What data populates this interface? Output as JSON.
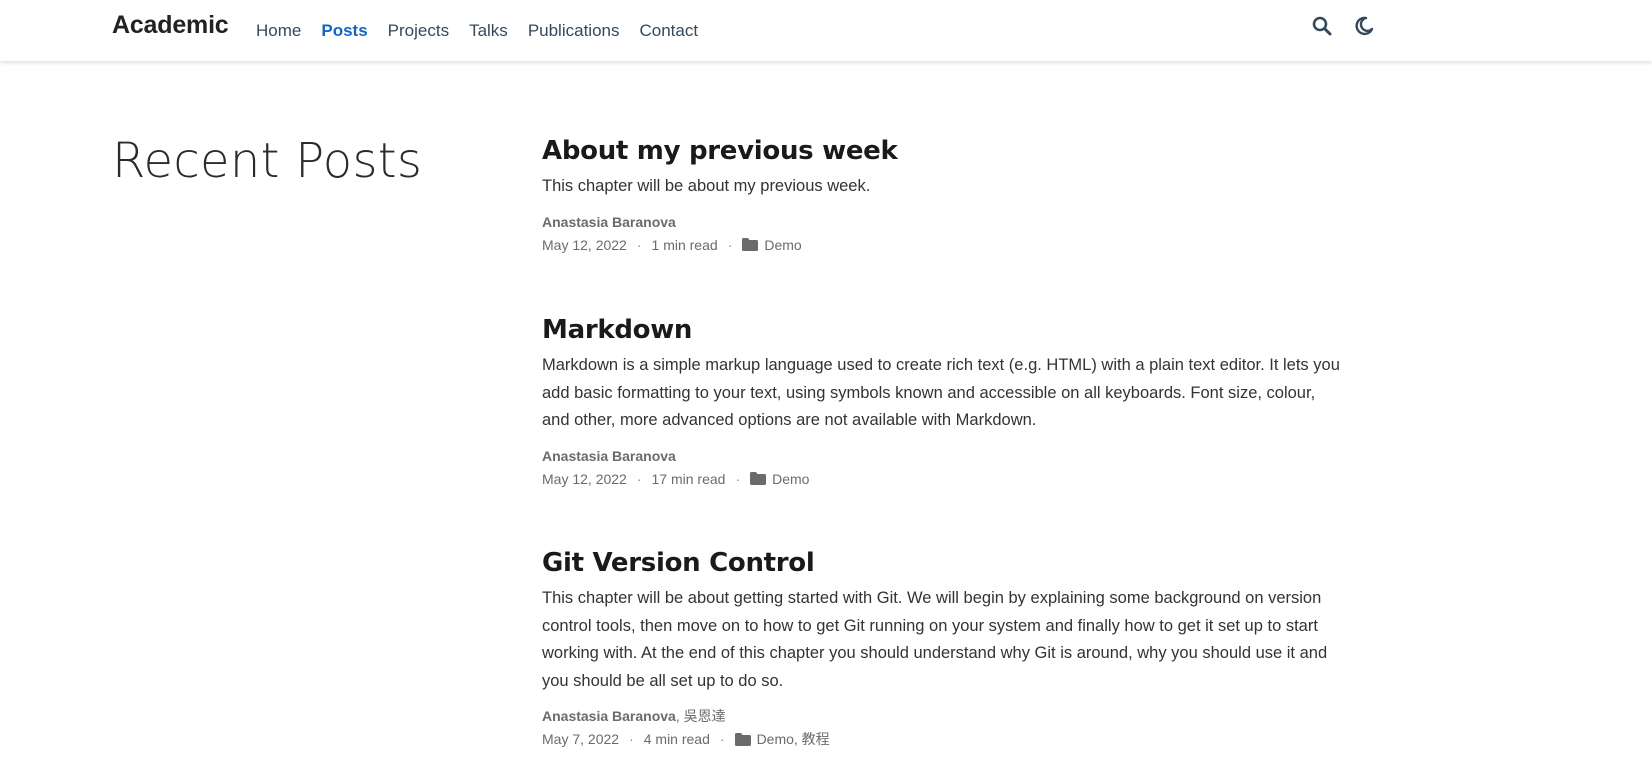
{
  "navbar": {
    "brand": "Academic",
    "links": [
      {
        "label": "Home",
        "active": false
      },
      {
        "label": "Posts",
        "active": true
      },
      {
        "label": "Projects",
        "active": false
      },
      {
        "label": "Talks",
        "active": false
      },
      {
        "label": "Publications",
        "active": false
      },
      {
        "label": "Contact",
        "active": false
      }
    ],
    "icons": [
      "search-icon",
      "moon-icon"
    ]
  },
  "main": {
    "section_title": "Recent Posts",
    "posts": [
      {
        "title": "About my previous week",
        "summary": "This chapter will be about my previous week.",
        "author": "Anastasia Baranova",
        "coauthor": "",
        "date": "May 12, 2022",
        "read_time": "1 min read",
        "categories": "Demo"
      },
      {
        "title": "Markdown",
        "summary": "Markdown is a simple markup language used to create rich text (e.g. HTML) with a plain text editor. It lets you add basic formatting to your text, using symbols known and accessible on all keyboards. Font size, colour, and other, more advanced options are not available with Markdown.",
        "author": "Anastasia Baranova",
        "coauthor": "",
        "date": "May 12, 2022",
        "read_time": "17 min read",
        "categories": "Demo"
      },
      {
        "title": "Git Version Control",
        "summary": "This chapter will be about getting started with Git. We will begin by explaining some background on version control tools, then move on to how to get Git running on your system and finally how to get it set up to start working with. At the end of this chapter you should understand why Git is around, why you should use it and you should be all set up to do so.",
        "author": "Anastasia Baranova",
        "coauthor": ", 吳恩達",
        "date": "May 7, 2022",
        "read_time": "4 min read",
        "categories": "Demo, 教程"
      }
    ]
  },
  "colors": {
    "accent": "#1565c0",
    "nav_text": "#34495e",
    "meta_text": "#6b6b6b"
  }
}
